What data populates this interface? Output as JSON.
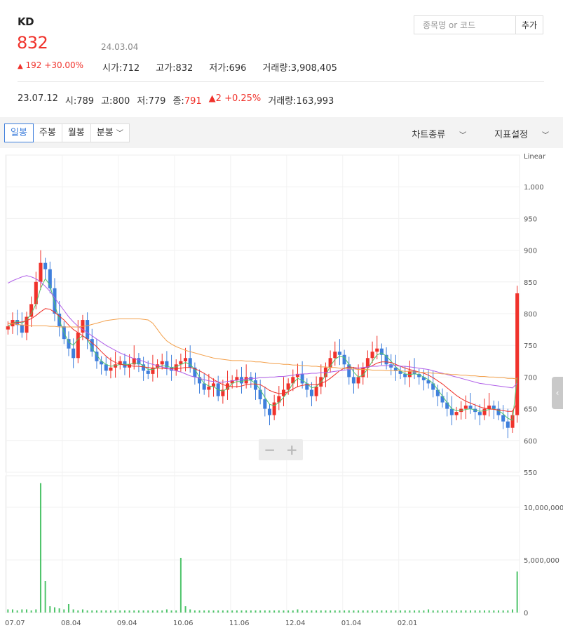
{
  "stock": {
    "name": "KD",
    "price": "832",
    "date": "24.03.04",
    "change_amount": "192",
    "change_percent": "+30.00%",
    "change_arrow": "▲",
    "stats": [
      {
        "label": "시가",
        "value": "712"
      },
      {
        "label": "고가",
        "value": "832"
      },
      {
        "label": "저가",
        "value": "696"
      },
      {
        "label": "거래량",
        "value": "3,908,405"
      }
    ]
  },
  "search": {
    "placeholder": "종목명 or 코드",
    "add_label": "추가"
  },
  "history": {
    "date": "23.07.12",
    "open_label": "시",
    "open": "789",
    "high_label": "고",
    "high": "800",
    "low_label": "저",
    "low": "779",
    "close_label": "종",
    "close": "791",
    "change_arrow": "▲",
    "change": "2",
    "change_percent": "+0.25%",
    "volume_label": "거래량",
    "volume": "163,993"
  },
  "toolbar": {
    "tabs": [
      "일봉",
      "주봉",
      "월봉",
      "분봉"
    ],
    "active_tab": "일봉",
    "chart_type_label": "차트종류",
    "indicator_label": "지표설정"
  },
  "colors": {
    "up": "#f0322b",
    "down": "#3f7fdc",
    "ma5": "#4fc46b",
    "ma20": "#f0322b",
    "ma60": "#b05fe8",
    "ma120": "#f3a04b",
    "volume": "#4fc46b"
  },
  "chart_data": {
    "type": "candlestick",
    "scale_label": "Linear",
    "price_ticks": [
      "1,000",
      "950",
      "900",
      "850",
      "800",
      "750",
      "700",
      "650",
      "600",
      "550"
    ],
    "price_tick_values": [
      1000,
      950,
      900,
      850,
      800,
      750,
      700,
      650,
      600,
      550
    ],
    "price_range": [
      550,
      1050
    ],
    "volume_ticks": [
      "10,000,000",
      "5,000,000",
      "0"
    ],
    "volume_tick_values": [
      10000000,
      5000000,
      0
    ],
    "x_labels": [
      "07.07",
      "08.04",
      "09.04",
      "10.06",
      "11.06",
      "12.04",
      "01.04",
      "02.01"
    ],
    "price_path": [
      780,
      790,
      782,
      770,
      795,
      815,
      850,
      880,
      870,
      840,
      800,
      780,
      760,
      745,
      730,
      770,
      790,
      760,
      740,
      725,
      720,
      710,
      715,
      720,
      725,
      715,
      720,
      730,
      720,
      710,
      705,
      715,
      720,
      725,
      715,
      710,
      720,
      725,
      730,
      715,
      700,
      690,
      680,
      685,
      690,
      670,
      680,
      690,
      695,
      700,
      690,
      700,
      695,
      680,
      665,
      650,
      640,
      660,
      670,
      680,
      690,
      700,
      705,
      690,
      680,
      670,
      685,
      700,
      715,
      730,
      740,
      735,
      720,
      700,
      690,
      700,
      715,
      730,
      740,
      745,
      735,
      720,
      715,
      710,
      705,
      700,
      710,
      705,
      700,
      695,
      690,
      680,
      670,
      660,
      650,
      640,
      645,
      650,
      655,
      650,
      645,
      640,
      650,
      655,
      650,
      640,
      630,
      620,
      640,
      832
    ],
    "ma_lines": {
      "ma5": [
        780,
        785,
        788,
        785,
        790,
        800,
        815,
        840,
        855,
        845,
        815,
        790,
        770,
        755,
        750,
        760,
        765,
        760,
        745,
        735,
        725,
        720,
        717,
        718,
        720,
        720,
        720,
        722,
        722,
        718,
        712,
        712,
        715,
        718,
        717,
        715,
        716,
        720,
        723,
        720,
        712,
        700,
        690,
        686,
        685,
        680,
        678,
        682,
        690,
        693,
        693,
        695,
        695,
        690,
        680,
        668,
        657,
        655,
        660,
        668,
        678,
        690,
        698,
        695,
        690,
        683,
        685,
        692,
        703,
        717,
        728,
        733,
        731,
        720,
        708,
        700,
        703,
        713,
        725,
        735,
        738,
        733,
        725,
        716,
        710,
        705,
        704,
        705,
        704,
        700,
        696,
        690,
        680,
        670,
        660,
        650,
        647,
        647,
        649,
        650,
        648,
        646,
        647,
        649,
        650,
        647,
        642,
        635,
        632,
        700
      ],
      "ma20": [
        785,
        785,
        786,
        787,
        789,
        792,
        797,
        803,
        808,
        807,
        802,
        796,
        790,
        782,
        775,
        770,
        765,
        760,
        754,
        748,
        740,
        733,
        727,
        723,
        720,
        719,
        718,
        717,
        717,
        716,
        715,
        714,
        714,
        714,
        713,
        713,
        713,
        714,
        715,
        715,
        713,
        710,
        706,
        701,
        696,
        692,
        688,
        686,
        685,
        685,
        686,
        688,
        689,
        689,
        688,
        684,
        679,
        676,
        674,
        674,
        677,
        681,
        685,
        687,
        688,
        688,
        688,
        690,
        693,
        698,
        704,
        710,
        714,
        716,
        715,
        714,
        714,
        715,
        718,
        722,
        724,
        724,
        723,
        720,
        717,
        714,
        712,
        710,
        708,
        706,
        703,
        699,
        694,
        689,
        683,
        677,
        671,
        666,
        662,
        659,
        656,
        653,
        651,
        650,
        649,
        648,
        647,
        646,
        646,
        660
      ],
      "ma60": [
        848,
        852,
        855,
        858,
        860,
        858,
        855,
        850,
        843,
        835,
        825,
        815,
        805,
        795,
        787,
        780,
        775,
        770,
        765,
        760,
        755,
        750,
        746,
        742,
        738,
        735,
        732,
        729,
        727,
        725,
        722,
        720,
        718,
        716,
        714,
        712,
        710,
        708,
        705,
        702,
        700,
        698,
        696,
        694,
        693,
        692,
        692,
        693,
        694,
        695,
        696,
        697,
        698,
        698,
        699,
        699,
        700,
        700,
        701,
        701,
        702,
        703,
        704,
        705,
        705,
        706,
        706,
        707,
        707,
        708,
        709,
        710,
        711,
        712,
        713,
        714,
        715,
        716,
        717,
        717,
        718,
        718,
        718,
        718,
        717,
        717,
        716,
        715,
        714,
        713,
        712,
        710,
        708,
        706,
        704,
        702,
        700,
        698,
        696,
        694,
        692,
        690,
        689,
        688,
        687,
        686,
        685,
        684,
        683,
        690
      ],
      "ma120": [
        785,
        784,
        783,
        782,
        782,
        781,
        781,
        781,
        781,
        780,
        780,
        779,
        779,
        779,
        779,
        779,
        780,
        781,
        783,
        785,
        787,
        789,
        790,
        791,
        792,
        792,
        792,
        792,
        792,
        791,
        790,
        785,
        775,
        765,
        757,
        752,
        748,
        745,
        742,
        740,
        738,
        736,
        734,
        732,
        730,
        729,
        728,
        727,
        726,
        726,
        726,
        725,
        725,
        724,
        724,
        723,
        722,
        721,
        721,
        720,
        720,
        719,
        719,
        718,
        718,
        717,
        717,
        716,
        716,
        715,
        715,
        714,
        714,
        713,
        713,
        712,
        712,
        712,
        711,
        711,
        711,
        710,
        710,
        710,
        710,
        709,
        709,
        708,
        708,
        707,
        707,
        706,
        706,
        705,
        705,
        704,
        704,
        703,
        703,
        702,
        702,
        701,
        701,
        700,
        700,
        699,
        699,
        698,
        698,
        697
      ]
    },
    "volume_path_millions": [
      0.3,
      0.3,
      0.2,
      0.3,
      0.3,
      0.2,
      0.3,
      12.3,
      3.0,
      0.6,
      0.5,
      0.4,
      0.3,
      0.8,
      0.3,
      0.2,
      0.3,
      0.2,
      0.2,
      0.2,
      0.2,
      0.2,
      0.2,
      0.2,
      0.2,
      0.2,
      0.2,
      0.2,
      0.2,
      0.2,
      0.2,
      0.2,
      0.2,
      0.2,
      0.3,
      0.2,
      0.2,
      5.2,
      0.6,
      0.3,
      0.2,
      0.2,
      0.2,
      0.2,
      0.2,
      0.2,
      0.2,
      0.2,
      0.2,
      0.2,
      0.2,
      0.2,
      0.2,
      0.2,
      0.2,
      0.2,
      0.2,
      0.2,
      0.2,
      0.2,
      0.2,
      0.2,
      0.3,
      0.2,
      0.2,
      0.2,
      0.2,
      0.2,
      0.2,
      0.2,
      0.2,
      0.2,
      0.2,
      0.2,
      0.2,
      0.2,
      0.2,
      0.2,
      0.2,
      0.2,
      0.2,
      0.2,
      0.2,
      0.2,
      0.2,
      0.2,
      0.2,
      0.2,
      0.2,
      0.2,
      0.3,
      0.2,
      0.2,
      0.2,
      0.2,
      0.2,
      0.2,
      0.2,
      0.2,
      0.2,
      0.2,
      0.2,
      0.2,
      0.2,
      0.2,
      0.2,
      0.2,
      0.2,
      0.3,
      3.9
    ]
  }
}
